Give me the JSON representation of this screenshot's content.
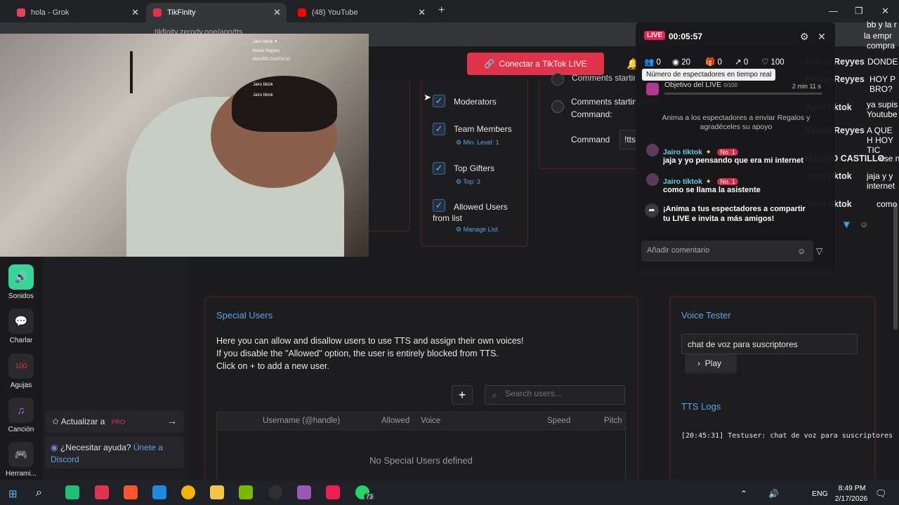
{
  "tabs": [
    {
      "label": "hola - Grok"
    },
    {
      "label": "TikFinity"
    },
    {
      "label": "(48) YouTube"
    }
  ],
  "address": {
    "url": "tikfinity.zerody.one/app/tts"
  },
  "header": {
    "connect_label": "Conectar a TikTok LIVE"
  },
  "permissions": {
    "moderators": "Moderators",
    "team_members": "Team Members",
    "team_members_sub": "Min. Level: 1",
    "top_gifters": "Top Gifters",
    "top_gifters_sub": "Top: 3",
    "allowed_users": "Allowed Users from list",
    "allowed_users_sub": "Manage List"
  },
  "commands": {
    "comments_starting_with_command": "Comments starting with Command:",
    "comments_starting_partial": "Comments startin",
    "command_label": "Command",
    "command_value": "!tts"
  },
  "rail": [
    {
      "label": "Sonidos",
      "icon": "speaker-icon"
    },
    {
      "label": "Charlar",
      "icon": "chat-icon"
    },
    {
      "label": "Agujas",
      "icon": "gauge-icon"
    },
    {
      "label": "Canción",
      "icon": "music-icon"
    },
    {
      "label": "Herrami...",
      "icon": "gamepad-icon"
    }
  ],
  "side": {
    "upgrade_label": "Actualizar a",
    "upgrade_badge": "PRO",
    "help_text": "¿Necesitar ayuda?",
    "help_link": "Únete a Discord"
  },
  "special_users": {
    "title": "Special Users",
    "line1": "Here you can allow and disallow users to use TTS and assign their own voices!",
    "line2": "If you disable the \"Allowed\" option, the user is entirely blocked from TTS.",
    "line3": "Click on + to add a new user.",
    "search_placeholder": "Search users...",
    "columns": [
      "Username (@handle)",
      "Allowed",
      "Voice",
      "Speed",
      "Pitch"
    ],
    "empty": "No Special Users defined"
  },
  "voice_tester": {
    "title": "Voice Tester",
    "input_value": "chat de voz para suscriptores",
    "play_label": "Play",
    "logs_title": "TTS Logs",
    "log_line": "[20:45:31] Testuser: chat de voz para suscriptores"
  },
  "live": {
    "badge": "LIVE",
    "timer": "00:05:57",
    "stats": {
      "viewers_now": "0",
      "views": "20",
      "gifts": "0",
      "shares": "0",
      "likes": "100"
    },
    "tooltip": "Número de espectadores en tiempo real",
    "goal_label": "Objetivo del LIVE",
    "goal_value": "0/100",
    "goal_time": "2 min 11 s",
    "encourage": "Anima a los espectadores a enviar Regalos y agradéceles su apoyo",
    "messages": [
      {
        "user": "Jairo tiktok",
        "badge": "No. 1",
        "text": "jaja y yo pensando que era mi internet"
      },
      {
        "user": "Jairo tiktok",
        "badge": "No. 1",
        "text": "como se llama la asistente"
      }
    ],
    "share_prompt": "¡Anima a tus espectadores a compartir tu LIVE e invita a más amigos!",
    "comment_placeholder": "Añadir comentario"
  },
  "overlay_chat": [
    {
      "name": "Kelvin Reyyes",
      "text": "DONDE"
    },
    {
      "name": "Kelvin Reyyes",
      "text": "HOY P BRO?"
    },
    {
      "name": "Jairo tiktok",
      "text": "ya supis Youtube"
    },
    {
      "name": "Kelvin Reyyes",
      "text": "A QUE H HOY TIC"
    },
    {
      "name": "MAURO CASTILLO",
      "text": "ese n"
    },
    {
      "name": "Jairo tiktok",
      "text": "jaja y y internet"
    },
    {
      "name": "Jairo tiktok",
      "text": "como"
    }
  ],
  "overlay_top": {
    "line1": "bb y la r",
    "line2": "la empr",
    "line3": "compra"
  },
  "taskbar": {
    "lang": "ENG",
    "time": "8:49 PM",
    "date": "2/17/2026",
    "whatsapp_badge": "73"
  },
  "colors": {
    "accent_red": "#e2334d",
    "link_blue": "#5aa3e6",
    "card_border": "#5a1f26",
    "live_red": "#ee1d52"
  }
}
